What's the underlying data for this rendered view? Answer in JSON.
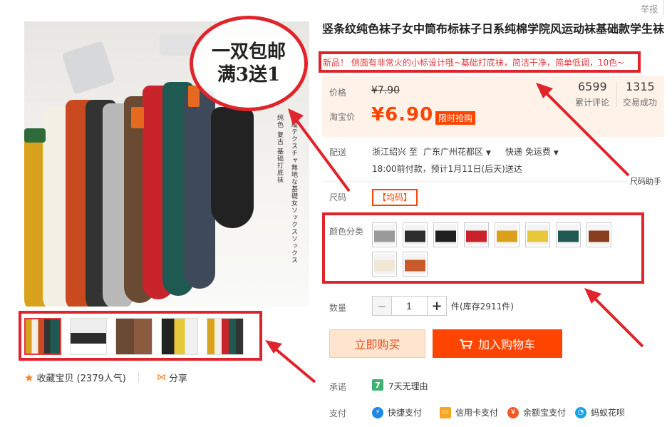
{
  "report": "举报",
  "main_image": {
    "badge_line1": "一双包邮",
    "badge_line2": "满3送1",
    "vert_text_1": "纯色 复古 基础打底袜",
    "vert_text_2": "縦テクスチャ無地な基礎女ソックスソックス"
  },
  "thumbnails": [
    {
      "label": "thumb-1",
      "active": true
    },
    {
      "label": "thumb-2"
    },
    {
      "label": "thumb-3"
    },
    {
      "label": "thumb-4"
    },
    {
      "label": "thumb-5"
    }
  ],
  "favorite": "收藏宝贝 (2379人气)",
  "share": "分享",
  "product": {
    "title": "竖条纹纯色袜子女中筒布标袜子日系纯棉学院风运动袜基础款学生袜",
    "subtitle": "新品！ 侧面有非常火的小标设计哦~基础打底袜，简洁干净，简单低调，10色~"
  },
  "price": {
    "label": "价格",
    "original": "¥7.90",
    "promo_label": "淘宝价",
    "current": "¥6.90",
    "promo_tag": "限时抢购"
  },
  "stats": {
    "reviews_num": "6599",
    "reviews_label": "累计评论",
    "sales_num": "1315",
    "sales_label": "交易成功"
  },
  "shipping": {
    "label": "配送",
    "from": "浙江绍兴 至",
    "to": "广东广州花都区",
    "fee": "快递 免运费",
    "time": "18:00前付款，预计1月11日(后天)送达"
  },
  "size": {
    "label": "尺码",
    "option": "【均码】",
    "helper": "尺码助手"
  },
  "colors": {
    "label": "颜色分类",
    "swatches": [
      "#9a9a9a",
      "#2d2d2d",
      "#1f1f1f",
      "#c9242b",
      "#d9a21a",
      "#e8c83b",
      "#1f5a52",
      "#8b3e1f",
      "#f0e7d5",
      "#c95a2a"
    ]
  },
  "quantity": {
    "label": "数量",
    "value": "1",
    "minus": "−",
    "plus": "+",
    "unit": "件(库存2911件)"
  },
  "buttons": {
    "buy_now": "立即购买",
    "add_cart": "加入购物车"
  },
  "promise": {
    "label": "承诺",
    "icon_text": "7",
    "text": "7天无理由"
  },
  "payment": {
    "label": "支付",
    "methods": [
      "快捷支付",
      "信用卡支付",
      "余额宝支付",
      "蚂蚁花呗"
    ]
  }
}
